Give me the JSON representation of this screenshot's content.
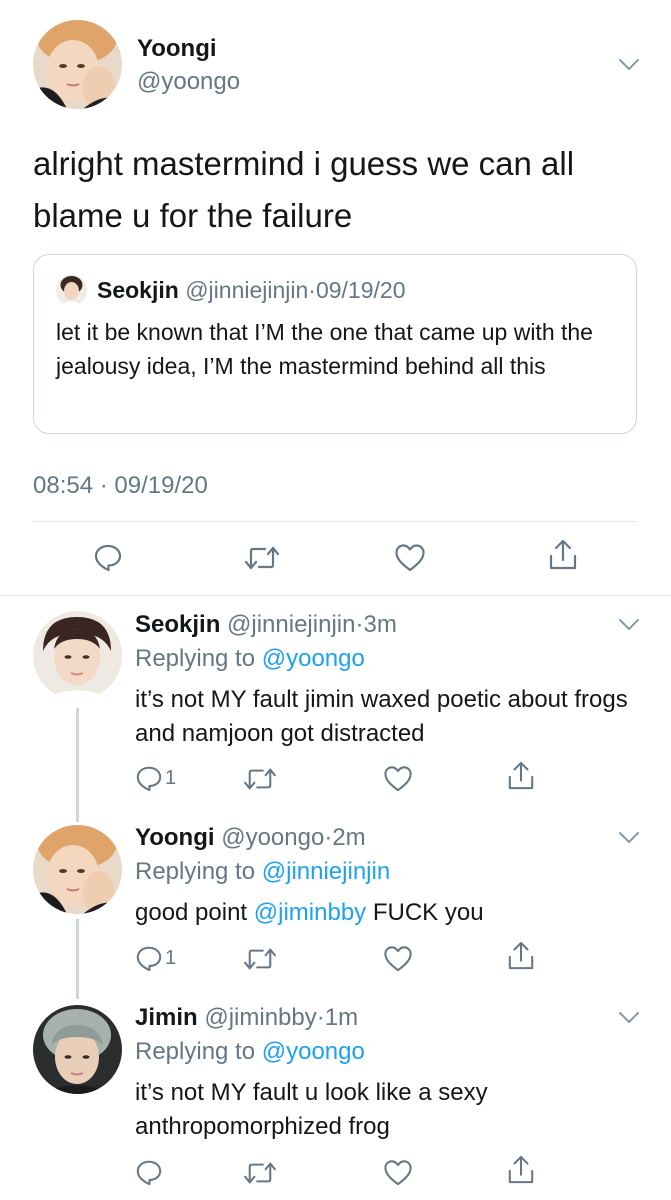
{
  "main_tweet": {
    "author": {
      "name": "Yoongi",
      "handle": "@yoongo",
      "avatar_icon": "avatar-photo"
    },
    "text": "alright mastermind i guess we can all blame u for the failure",
    "quote": {
      "name": "Seokjin",
      "handle": "@jinniejinjin",
      "separator": "·",
      "date": "09/19/20",
      "text": "let it be known that I’M the one that came up with the jealousy idea, I’M the mastermind behind all this"
    },
    "timestamp": "08:54 · 09/19/20",
    "actions": {
      "reply_icon": "reply-icon",
      "retweet_icon": "retweet-icon",
      "like_icon": "heart-icon",
      "share_icon": "share-icon"
    }
  },
  "replies": [
    {
      "name": "Seokjin",
      "handle": "@jinniejinjin",
      "separator": "·",
      "time": "3m",
      "replying_prefix": "Replying to",
      "replying_to": "@yoongo",
      "text": "it’s not MY fault jimin waxed poetic about frogs and namjoon got distracted",
      "reply_count": "1"
    },
    {
      "name": "Yoongi",
      "handle": "@yoongo",
      "separator": "·",
      "time": "2m",
      "replying_prefix": "Replying to",
      "replying_to": "@jinniejinjin",
      "text_before": "good point",
      "mention": "@jiminbby",
      "text_after": "FUCK you",
      "reply_count": "1"
    },
    {
      "name": "Jimin",
      "handle": "@jiminbby",
      "separator": "·",
      "time": "1m",
      "replying_prefix": "Replying to",
      "replying_to": "@yoongo",
      "text": "it’s not MY fault u look like a sexy anthropomorphized frog",
      "reply_count": ""
    }
  ],
  "colors": {
    "link": "#1da1f2",
    "secondary_text": "#657786",
    "divider": "#e1e8ed",
    "thread_line": "#ccd6dd"
  }
}
